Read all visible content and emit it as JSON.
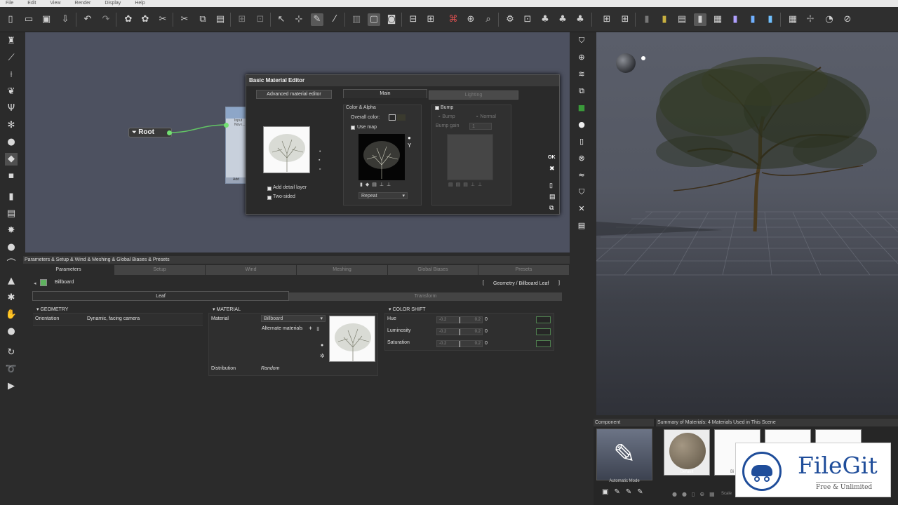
{
  "menu": [
    "File",
    "Edit",
    "View",
    "Render",
    "Display",
    "Help"
  ],
  "node": {
    "root_label": "Root",
    "input_label": "Input",
    "node_sub_label": "Nov i...",
    "node_add_label": "Add"
  },
  "dialog": {
    "title": "Basic Material Editor",
    "advanced_button": "Advanced material editor",
    "tab_main": "Main",
    "tab_lighting": "Lighting",
    "add_detail_layer": "Add detail layer",
    "two_sided": "Two-sided",
    "color_alpha_header": "Color & Alpha",
    "overall_color_label": "Overall color:",
    "use_map_label": "Use map",
    "wrap_mode": "Repeat",
    "bump_header": "Bump",
    "bump_option": "Bump",
    "normal_option": "Normal",
    "bump_gain_label": "Bump gain",
    "bump_gain_value": "1",
    "ok_label": "OK"
  },
  "params": {
    "header": "Parameters & Setup & Wind & Meshing & Global Biases & Presets",
    "tabs": [
      "Parameters",
      "Setup",
      "Wind",
      "Meshing",
      "Global Biases",
      "Presets"
    ],
    "item_label": "Billboard",
    "breadcrumb": "Geometry / Billboard Leaf",
    "bracket_open": "[",
    "bracket_close": "]",
    "subtabs": [
      "Leaf",
      "Transform"
    ],
    "geometry": {
      "header": "GEOMETRY",
      "orientation_label": "Orientation",
      "orientation_value": "Dynamic, facing camera"
    },
    "material": {
      "header": "MATERIAL",
      "material_label": "Material",
      "material_value": "Billboard",
      "alternate_label": "Alternate materials",
      "distribution_label": "Distribution",
      "distribution_value": "Random"
    },
    "color_shift": {
      "header": "COLOR SHIFT",
      "rows": [
        {
          "label": "Hue",
          "min": "-0.2",
          "max": "0.2",
          "value": "0"
        },
        {
          "label": "Luminosity",
          "min": "-0.2",
          "max": "0.2",
          "value": "0"
        },
        {
          "label": "Saturation",
          "min": "-0.2",
          "max": "0.2",
          "value": "0"
        }
      ]
    }
  },
  "materials_panel": {
    "component_label": "Component",
    "summary_label": "Summary of Materials: 4 Materials Used in This Scene",
    "automatic_mode": "Automatic Mode",
    "default_label": "Default",
    "thumb_label_2": "Bi",
    "scale_label": "Scale"
  },
  "watermark": {
    "brand": "FileGit",
    "tagline": "Free & Unlimited"
  }
}
